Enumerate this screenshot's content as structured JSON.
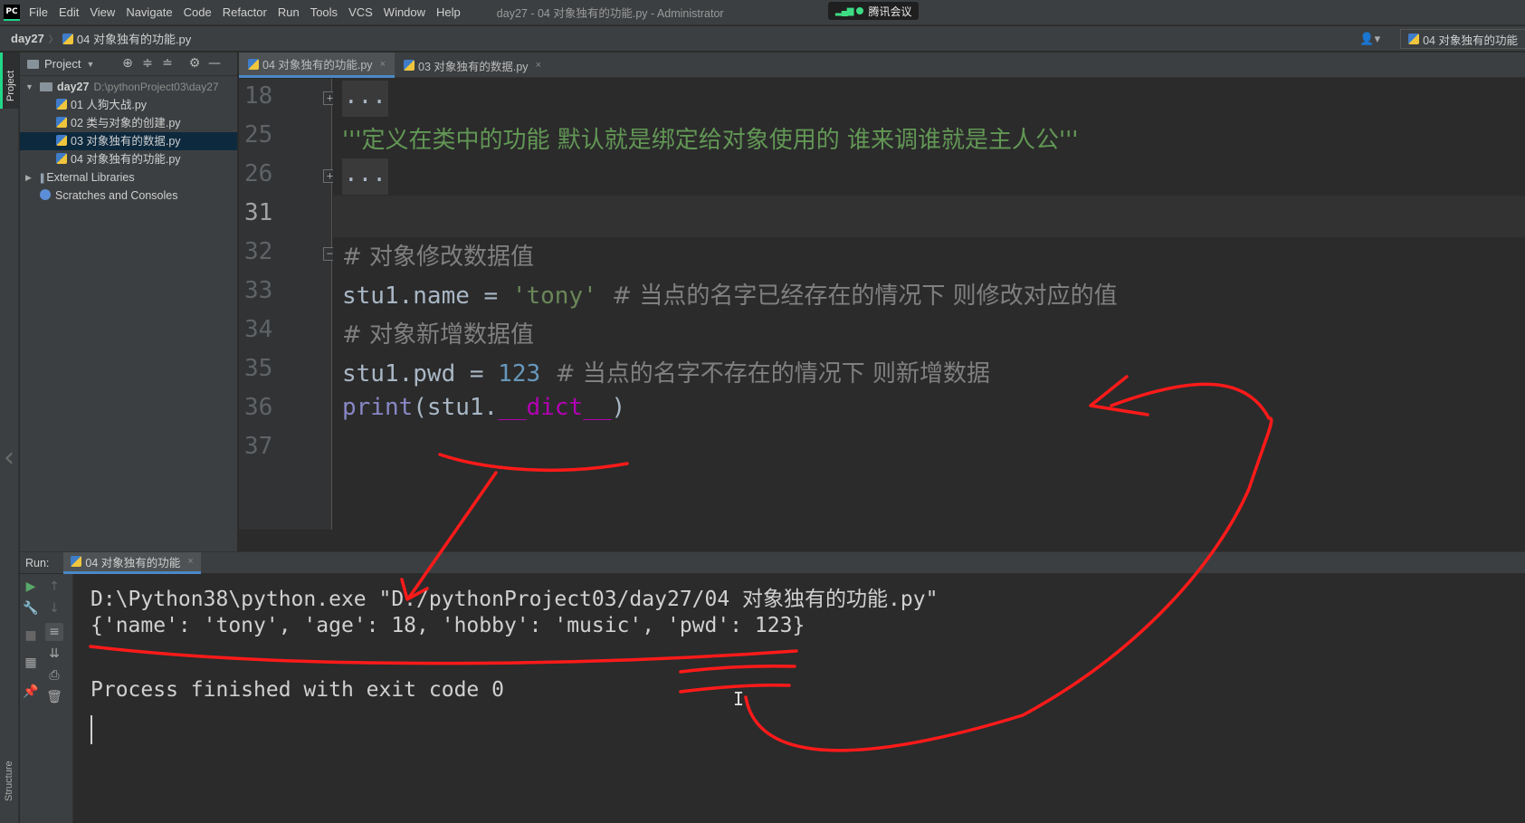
{
  "menubar": {
    "logo": "PC",
    "items": [
      "File",
      "Edit",
      "View",
      "Navigate",
      "Code",
      "Refactor",
      "Run",
      "Tools",
      "VCS",
      "Window",
      "Help"
    ],
    "window_title": "day27 - 04 对象独有的功能.py - Administrator",
    "meeting_app": "腾讯会议"
  },
  "navbar": {
    "root": "day27",
    "file": "04 对象独有的功能.py",
    "run_config": "04 对象独有的功能"
  },
  "left_stripe": {
    "project_tab": "Project",
    "structure_tab": "Structure"
  },
  "project": {
    "header": "Project",
    "tree": [
      {
        "label": "day27",
        "hint": "D:\\pythonProject03\\day27"
      },
      {
        "label": "01 人狗大战.py"
      },
      {
        "label": "02 类与对象的创建.py"
      },
      {
        "label": "03 对象独有的数据.py"
      },
      {
        "label": "04 对象独有的功能.py"
      },
      {
        "label": "External Libraries"
      },
      {
        "label": "Scratches and Consoles"
      }
    ]
  },
  "editor": {
    "tabs": [
      {
        "label": "04 对象独有的功能.py",
        "close": "×"
      },
      {
        "label": "03 对象独有的数据.py",
        "close": "×"
      }
    ],
    "fold_placeholder": "...",
    "line_numbers": [
      "18",
      "25",
      "26",
      "31",
      "32",
      "33",
      "34",
      "35",
      "36",
      "37"
    ],
    "lines": {
      "l25": "'''定义在类中的功能 默认就是绑定给对象使用的 谁来调谁就是主人公'''",
      "l32": "# 对象修改数据值",
      "l33_code": "stu1.name = ",
      "l33_str": "'tony'",
      "l33_comment": "  # 当点的名字已经存在的情况下 则修改对应的值",
      "l34": "# 对象新增数据值",
      "l35_code": "stu1.pwd = ",
      "l35_num": "123",
      "l35_comment": "  # 当点的名字不存在的情况下 则新增数据",
      "l36_builtin": "print",
      "l36_open": "(stu1.",
      "l36_magic": "__dict__",
      "l36_close": ")"
    }
  },
  "run": {
    "label": "Run:",
    "tab": "04 对象独有的功能",
    "close": "×",
    "output": [
      "D:\\Python38\\python.exe \"D:/pythonProject03/day27/04 对象独有的功能.py\"",
      "{'name': 'tony', 'age': 18, 'hobby': 'music', 'pwd': 123}",
      "Process finished with exit code 0"
    ]
  },
  "colors": {
    "accent_green": "#21d789",
    "selection_blue": "#0d293e",
    "annotation_red": "#ff1a1a"
  }
}
